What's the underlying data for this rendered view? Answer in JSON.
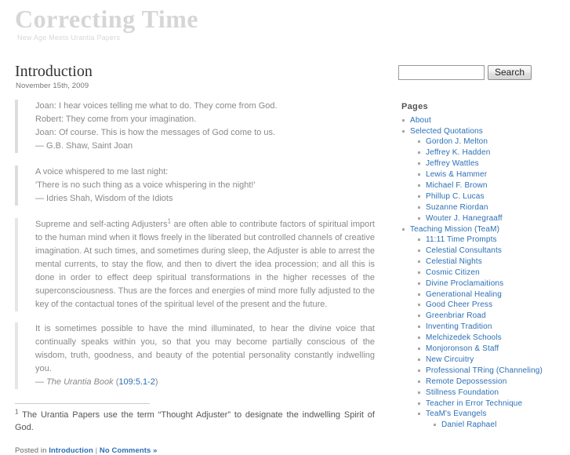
{
  "site": {
    "title": "Correcting Time",
    "tagline": "New Age Meets Urantia Papers"
  },
  "search": {
    "value": "",
    "placeholder": "",
    "button_label": "Search"
  },
  "post": {
    "title": "Introduction",
    "date": "November 15th, 2009",
    "quote1": {
      "lines": [
        "Joan: I hear voices telling me what to do. They come from God.",
        "Robert: They come from your imagination.",
        "Joan: Of course. This is how the messages of God come to us.",
        "— G.B. Shaw, Saint Joan"
      ]
    },
    "quote2": {
      "lines": [
        "A voice whispered to me last night:",
        "'There is no such thing as a voice whispering in the night!'",
        "— Idries Shah, Wisdom of the Idiots"
      ]
    },
    "para1_before_marker": "Supreme and self-acting Adjusters",
    "para1_marker": "1",
    "para1_after_marker": " are often able to contribute factors of spiritual import to the human mind when it flows freely in the liberated but controlled channels of creative imagination. At such times, and sometimes during sleep, the Adjuster is able to arrest the mental currents, to stay the flow, and then to divert the idea procession; and all this is done in order to effect deep spiritual transformations in the higher recesses of the superconsciousness. Thus are the forces and energies of mind more fully adjusted to the key of the contactual tones of the spiritual level of the present and the future.",
    "para2": "It is sometimes possible to have the mind illuminated, to hear the divine voice that continually speaks within you, so that you may become partially conscious of the wisdom, truth, goodness, and beauty of the potential personality constantly indwelling you.",
    "citation_dash": "— ",
    "citation_work": "The Urantia Book",
    "citation_open": " (",
    "citation_ref": "109:5.1-2",
    "citation_close": ")",
    "footnote_marker": "1",
    "footnote_text": " The Urantia Papers use the term “Thought Adjuster” to designate the indwelling Spirit of God.",
    "meta_prefix": "Posted in ",
    "meta_category": "Introduction",
    "meta_separator": " | ",
    "meta_comments": "No Comments »"
  },
  "sidebar": {
    "pages_title": "Pages",
    "items": [
      {
        "label": "About",
        "level": 1
      },
      {
        "label": "Selected Quotations",
        "level": 1
      },
      {
        "label": "Gordon J. Melton",
        "level": 2
      },
      {
        "label": "Jeffrey K. Hadden",
        "level": 2
      },
      {
        "label": "Jeffrey Wattles",
        "level": 2
      },
      {
        "label": "Lewis & Hammer",
        "level": 2
      },
      {
        "label": "Michael F. Brown",
        "level": 2
      },
      {
        "label": "Phillup C. Lucas",
        "level": 2
      },
      {
        "label": "Suzanne Riordan",
        "level": 2
      },
      {
        "label": "Wouter J. Hanegraaff",
        "level": 2
      },
      {
        "label": "Teaching Mission (TeaM)",
        "level": 1
      },
      {
        "label": "11:11 Time Prompts",
        "level": 2
      },
      {
        "label": "Celestial Consultants",
        "level": 2
      },
      {
        "label": "Celestial Nights",
        "level": 2
      },
      {
        "label": "Cosmic Citizen",
        "level": 2
      },
      {
        "label": "Divine Proclamaitions",
        "level": 2
      },
      {
        "label": "Generational Healing",
        "level": 2
      },
      {
        "label": "Good Cheer Press",
        "level": 2
      },
      {
        "label": "Greenbriar Road",
        "level": 2
      },
      {
        "label": "Inventing Tradition",
        "level": 2
      },
      {
        "label": "Melchizedek Schools",
        "level": 2
      },
      {
        "label": "Monjoronson & Staff",
        "level": 2
      },
      {
        "label": "New Circuitry",
        "level": 2
      },
      {
        "label": "Professional TRing (Channeling)",
        "level": 2
      },
      {
        "label": "Remote Depossession",
        "level": 2
      },
      {
        "label": "Stillness Foundation",
        "level": 2
      },
      {
        "label": "Teacher in Error Technique",
        "level": 2
      },
      {
        "label": "TeaM's Evangels",
        "level": 2
      },
      {
        "label": "Daniel Raphael",
        "level": 3
      }
    ]
  },
  "colors": {
    "link": "#2c6fb5",
    "title": "#d6d6d6",
    "body_text": "#8a8a8a",
    "heading": "#333333"
  }
}
